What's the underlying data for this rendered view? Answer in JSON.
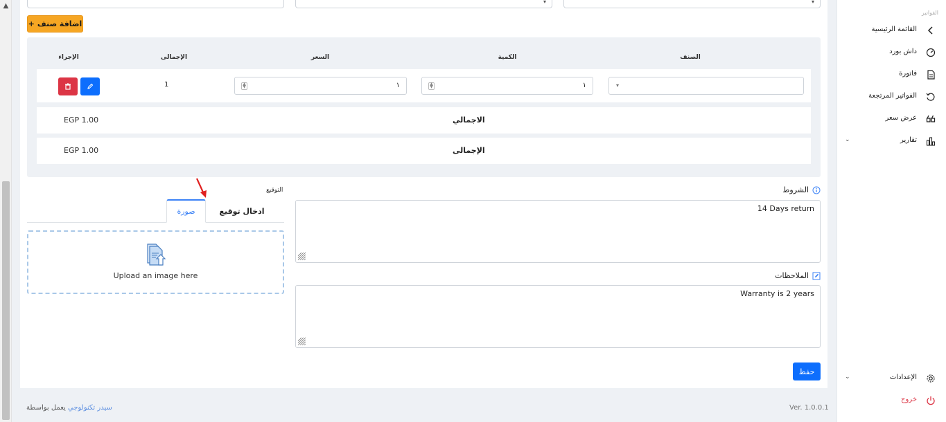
{
  "sidebar": {
    "section_label": "الفواتير",
    "items": [
      {
        "label": "القائمة الرئيسية",
        "icon": "chevron-left-icon"
      },
      {
        "label": "داش بورد",
        "icon": "dashboard-gauge-icon"
      },
      {
        "label": "فاتورة",
        "icon": "invoice-icon"
      },
      {
        "label": "الفواتير المرتجعة",
        "icon": "refund-icon"
      },
      {
        "label": "عرض سعر",
        "icon": "quote-icon"
      },
      {
        "label": "تقارير",
        "icon": "bar-chart-icon"
      }
    ],
    "settings_label": "الإعدادات",
    "logout_label": "خروج"
  },
  "invoice": {
    "add_item_label": "اضافة صنف",
    "columns": {
      "item": "الصنف",
      "quantity": "الكمية",
      "price": "السعر",
      "total": "الإجمالى",
      "action": "الإجراء"
    },
    "line": {
      "quantity": "١",
      "price": "١",
      "total": "1"
    },
    "summary": [
      {
        "label": "الاجمالي",
        "amount": "EGP 1.00"
      },
      {
        "label": "الإجمالى",
        "amount": "EGP 1.00"
      }
    ]
  },
  "terms": {
    "label": "الشروط",
    "value": "14 Days return"
  },
  "notes": {
    "label": "الملاحظات",
    "value": "Warranty is 2 years"
  },
  "signature": {
    "label": "التوقيع",
    "tabs": {
      "image": "صورة",
      "enter": "ادخال توقيع"
    },
    "upload_text": "Upload an image here"
  },
  "save_label": "حفظ",
  "footer": {
    "powered_prefix": "يعمل بواسطة",
    "brand": "سيدر تكنولوجي",
    "version": "Ver. 1.0.0.1"
  },
  "colors": {
    "primary": "#0d6efd",
    "warning": "#f6a623",
    "danger": "#dc3545"
  }
}
